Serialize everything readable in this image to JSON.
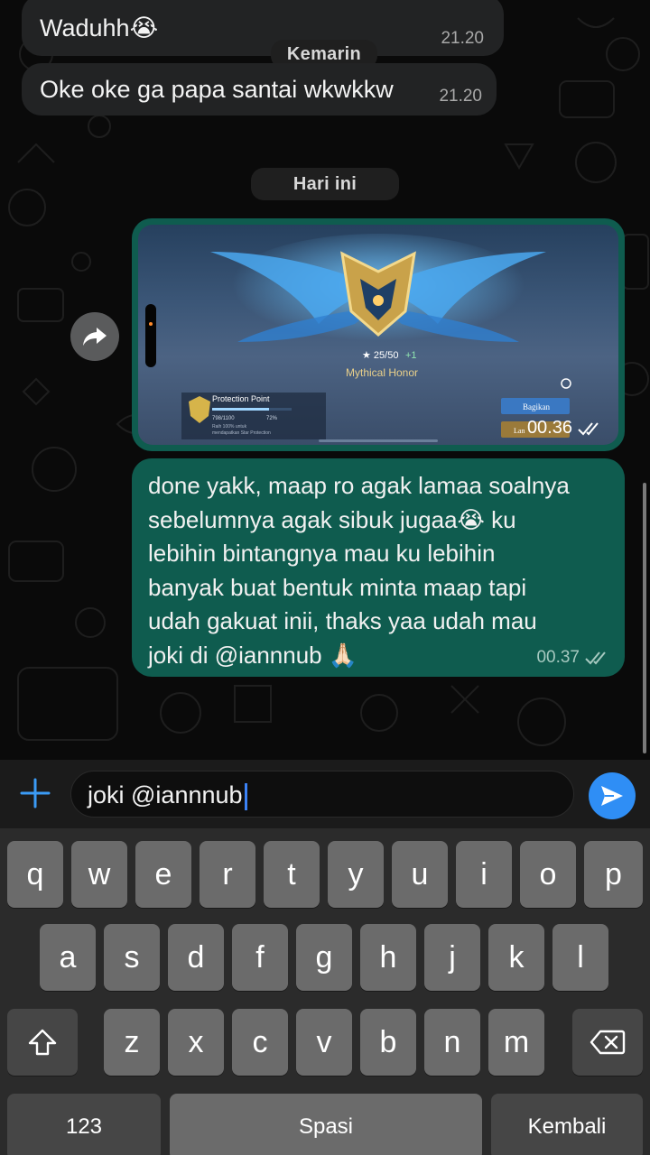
{
  "chat": {
    "messages_in": [
      {
        "text": "Waduhh😭",
        "time": "21.20"
      },
      {
        "text": "Oke oke ga papa santai wkwkkw",
        "time": "21.20"
      }
    ],
    "day_labels": {
      "yesterday": "Kemarin",
      "today": "Hari ini"
    },
    "media_message": {
      "time": "00.36",
      "status": "read"
    },
    "outgoing_message": {
      "lines": [
        "done yakk, maap ro agak lamaa soalnya",
        "sebelumnya agak sibuk jugaa😭 ku",
        "lebihin bintangnya mau ku lebihin",
        "banyak buat bentuk minta maap tapi",
        "udah gakuat inii, thaks yaa udah mau",
        "joki di @iannnub 🙏🏻"
      ],
      "time": "00.37",
      "status": "delivered"
    }
  },
  "screenshot": {
    "stars": "25/50",
    "stars_gain": "+1",
    "rank": "Mythical Honor",
    "protection_title": "Protection Point",
    "protection_value": "798/1100",
    "protection_percent": "72%",
    "protection_desc_1": "Raih 100% untuk",
    "protection_desc_2": "mendapatkan Star Protection",
    "share_label": "Bagikan",
    "continue_label": "Lan"
  },
  "composer": {
    "value": "joki @iannnub"
  },
  "keyboard": {
    "row1": [
      "q",
      "w",
      "e",
      "r",
      "t",
      "y",
      "u",
      "i",
      "o",
      "p"
    ],
    "row2": [
      "a",
      "s",
      "d",
      "f",
      "g",
      "h",
      "j",
      "k",
      "l"
    ],
    "row3": [
      "z",
      "x",
      "c",
      "v",
      "b",
      "n",
      "m"
    ],
    "numbers_label": "123",
    "space_label": "Spasi",
    "return_label": "Kembali"
  },
  "colors": {
    "outgoing_bubble": "#0f5c4f",
    "incoming_bubble": "#222324",
    "send_button": "#2f8ef5",
    "accent": "#3b82f6"
  }
}
